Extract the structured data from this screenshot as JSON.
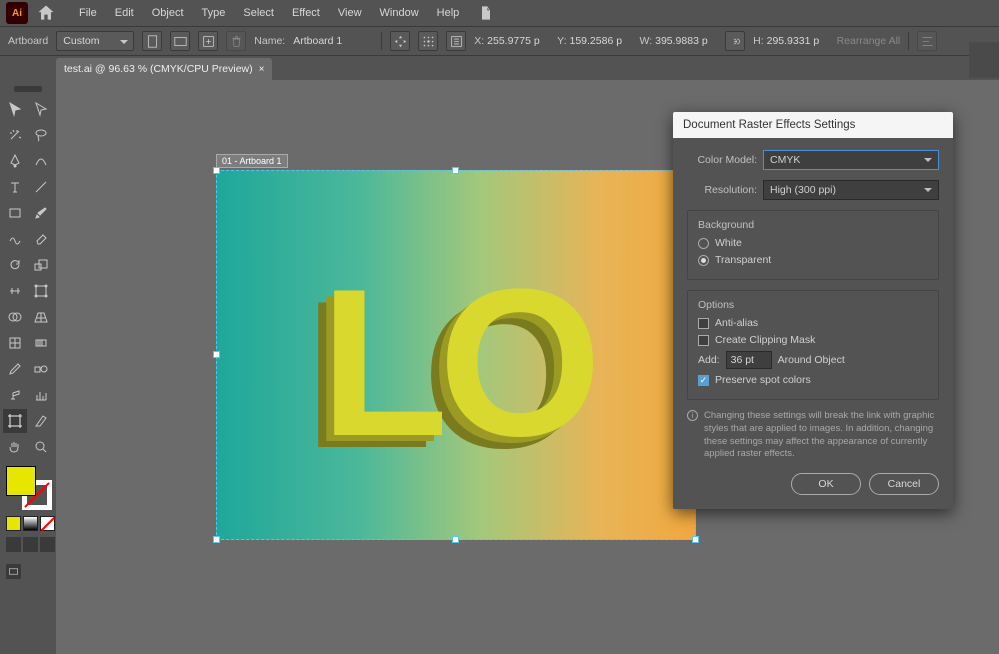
{
  "menu": [
    "File",
    "Edit",
    "Object",
    "Type",
    "Select",
    "Effect",
    "View",
    "Window",
    "Help"
  ],
  "control": {
    "mode": "Artboard",
    "preset": "Custom",
    "name_label": "Name:",
    "name_value": "Artboard 1",
    "X_label": "X:",
    "X": "255.9775 p",
    "Y_label": "Y:",
    "Y": "159.2586 p",
    "W_label": "W:",
    "W": "395.9883 p",
    "H_label": "H:",
    "H": "295.9331 p",
    "rearrange": "Rearrange All"
  },
  "tab": {
    "title": "test.ai @ 96.63 % (CMYK/CPU Preview)"
  },
  "artboard": {
    "tag": "01 - Artboard 1",
    "display_text": "LO"
  },
  "dialog": {
    "title": "Document Raster Effects Settings",
    "color_model_label": "Color Model:",
    "color_model": "CMYK",
    "resolution_label": "Resolution:",
    "resolution": "High (300 ppi)",
    "bg_group": "Background",
    "bg_white": "White",
    "bg_transparent": "Transparent",
    "bg_selected": "Transparent",
    "opt_group": "Options",
    "opt_antialias": "Anti-alias",
    "opt_clipmask": "Create Clipping Mask",
    "add_label": "Add:",
    "add_value": "36 pt",
    "add_suffix": "Around Object",
    "opt_spot": "Preserve spot colors",
    "note": "Changing these settings will break the link with graphic styles that are applied to images. In addition, changing these settings may affect the appearance of currently applied raster effects.",
    "ok": "OK",
    "cancel": "Cancel"
  }
}
